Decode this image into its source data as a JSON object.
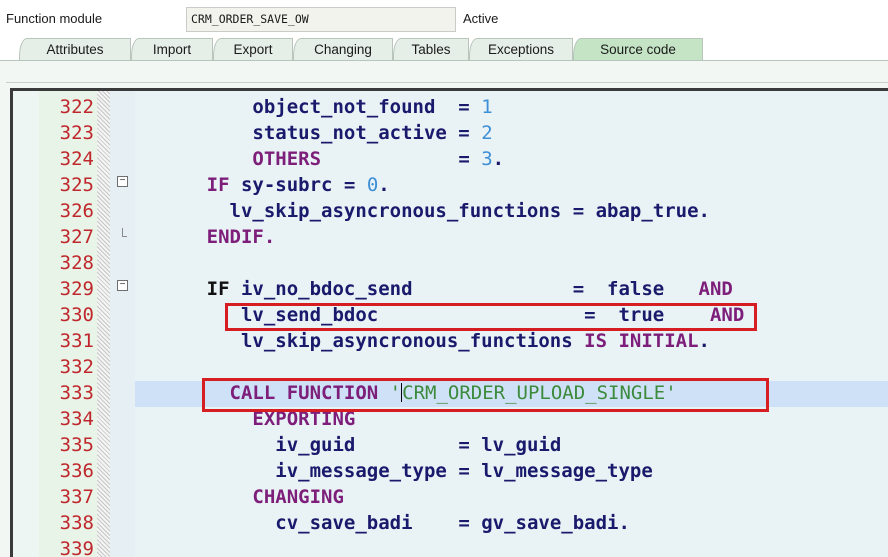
{
  "header": {
    "label": "Function module",
    "name": "CRM_ORDER_SAVE_OW",
    "status": "Active"
  },
  "tabs": [
    {
      "label": "Attributes",
      "active": false
    },
    {
      "label": "Import",
      "active": false
    },
    {
      "label": "Export",
      "active": false
    },
    {
      "label": "Changing",
      "active": false
    },
    {
      "label": "Tables",
      "active": false
    },
    {
      "label": "Exceptions",
      "active": false
    },
    {
      "label": "Source code",
      "active": true
    }
  ],
  "code": {
    "lines": [
      {
        "num": "322",
        "parts": [
          [
            "",
            "          "
          ],
          [
            "",
            "object_not_found  "
          ],
          [
            "op",
            "= "
          ],
          [
            "num",
            "1"
          ]
        ]
      },
      {
        "num": "323",
        "parts": [
          [
            "",
            "          "
          ],
          [
            "",
            "status_not_active "
          ],
          [
            "op",
            "= "
          ],
          [
            "num",
            "2"
          ]
        ]
      },
      {
        "num": "324",
        "parts": [
          [
            "",
            "          "
          ],
          [
            "kw",
            "OTHERS"
          ],
          [
            "",
            "            "
          ],
          [
            "op",
            "= "
          ],
          [
            "num",
            "3"
          ],
          [
            "",
            "."
          ]
        ]
      },
      {
        "num": "325",
        "parts": [
          [
            "",
            "      "
          ],
          [
            "kw",
            "IF "
          ],
          [
            "",
            "sy-subrc "
          ],
          [
            "op",
            "= "
          ],
          [
            "num",
            "0"
          ],
          [
            "",
            "."
          ]
        ]
      },
      {
        "num": "326",
        "parts": [
          [
            "",
            "        "
          ],
          [
            "",
            "lv_skip_asyncronous_functions "
          ],
          [
            "op",
            "= "
          ],
          [
            "",
            "abap_true."
          ]
        ]
      },
      {
        "num": "327",
        "parts": [
          [
            "",
            "      "
          ],
          [
            "kw",
            "ENDIF."
          ]
        ]
      },
      {
        "num": "328",
        "parts": []
      },
      {
        "num": "329",
        "parts": [
          [
            "",
            "      "
          ],
          [
            "dark",
            "IF "
          ],
          [
            "",
            "iv_no_bdoc_send              "
          ],
          [
            "op",
            "=  "
          ],
          [
            "",
            "false   "
          ],
          [
            "kw",
            "AND"
          ]
        ]
      },
      {
        "num": "330",
        "parts": [
          [
            "",
            "         "
          ],
          [
            "",
            "lv_send_bdoc                  "
          ],
          [
            "op",
            "=  "
          ],
          [
            "",
            "true    "
          ],
          [
            "kw",
            "AND"
          ]
        ]
      },
      {
        "num": "331",
        "parts": [
          [
            "",
            "         "
          ],
          [
            "",
            "lv_skip_asyncronous_functions "
          ],
          [
            "kw",
            "IS INITIAL"
          ],
          [
            "",
            "."
          ]
        ]
      },
      {
        "num": "332",
        "parts": []
      },
      {
        "num": "333",
        "parts": [
          [
            "",
            "        "
          ],
          [
            "kw",
            "CALL FUNCTION "
          ],
          [
            "str",
            "'"
          ],
          [
            "caret",
            ""
          ],
          [
            "str",
            "CRM_ORDER_UPLOAD_SINGLE'"
          ]
        ]
      },
      {
        "num": "334",
        "parts": [
          [
            "",
            "          "
          ],
          [
            "kw",
            "EXPORTING"
          ]
        ]
      },
      {
        "num": "335",
        "parts": [
          [
            "",
            "            "
          ],
          [
            "",
            "iv_guid         "
          ],
          [
            "op",
            "= "
          ],
          [
            "",
            "lv_guid"
          ]
        ]
      },
      {
        "num": "336",
        "parts": [
          [
            "",
            "            "
          ],
          [
            "",
            "iv_message_type "
          ],
          [
            "op",
            "= "
          ],
          [
            "",
            "lv_message_type"
          ]
        ]
      },
      {
        "num": "337",
        "parts": [
          [
            "",
            "          "
          ],
          [
            "kw",
            "CHANGING"
          ]
        ]
      },
      {
        "num": "338",
        "parts": [
          [
            "",
            "            "
          ],
          [
            "",
            "cv_save_badi    "
          ],
          [
            "op",
            "= "
          ],
          [
            "",
            "gv_save_badi."
          ]
        ]
      },
      {
        "num": "339",
        "parts": []
      }
    ]
  }
}
